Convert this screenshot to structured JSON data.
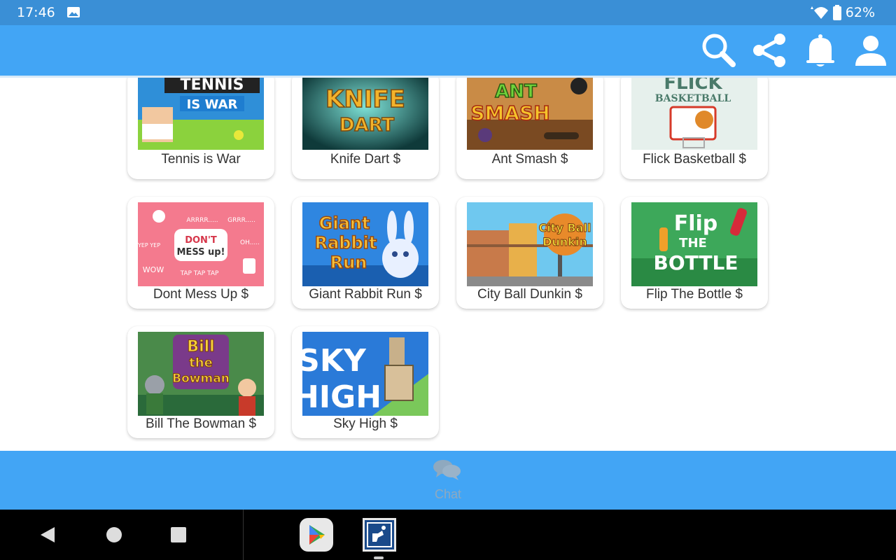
{
  "status_bar": {
    "time": "17:46",
    "battery": "62%"
  },
  "app_bar": {
    "icons": [
      "search-icon",
      "share-icon",
      "bell-icon",
      "account-icon"
    ]
  },
  "games": [
    {
      "title": "Tennis is War"
    },
    {
      "title": "Knife Dart $"
    },
    {
      "title": "Ant Smash $"
    },
    {
      "title": "Flick Basketball $"
    },
    {
      "title": "Dont Mess Up $"
    },
    {
      "title": "Giant Rabbit Run $"
    },
    {
      "title": "City Ball Dunkin $"
    },
    {
      "title": "Flip The Bottle $"
    },
    {
      "title": "Bill The Bowman $"
    },
    {
      "title": "Sky High $"
    }
  ],
  "thumb_text": {
    "tennis": [
      "TENNIS",
      "IS WAR"
    ],
    "knife": [
      "KNIFE",
      "DART"
    ],
    "ant": [
      "ANT",
      "SMASH"
    ],
    "flick": [
      "FLICK",
      "BASKETBALL"
    ],
    "dontmess": [
      "DON'T",
      "MESS up!",
      "ARRRR.....",
      "GRRR.....",
      "OH.....",
      "YEP YEP",
      "WOW",
      "TAP TAP TAP"
    ],
    "rabbit": [
      "Giant",
      "Rabbit",
      "Run"
    ],
    "city": [
      "City Ball",
      "Dunkin"
    ],
    "flip": [
      "Flip",
      "THE",
      "BOTTLE"
    ],
    "bill": [
      "Bill",
      "the",
      "Bowman"
    ],
    "sky": [
      "SKY",
      "HIGH"
    ]
  },
  "bottom_bar": {
    "chat_label": "Chat"
  },
  "colors": {
    "status_bar": "#3a8fd6",
    "app_bar": "#42a5f5",
    "bottom_bar": "#42a5f5"
  }
}
